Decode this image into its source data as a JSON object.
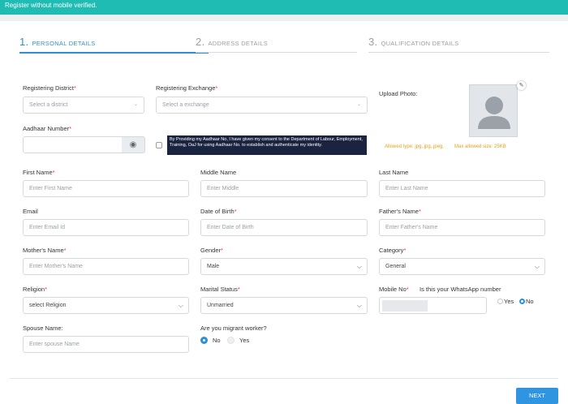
{
  "banner": {
    "text": "Register without mobile verified."
  },
  "steps": [
    {
      "num": "1.",
      "label": "PERSONAL DETAILS",
      "active": true
    },
    {
      "num": "2.",
      "label": "ADDRESS DETAILS",
      "active": false
    },
    {
      "num": "3.",
      "label": "QUALIFICATION DETAILS",
      "active": false
    }
  ],
  "fields": {
    "registering_district": {
      "label": "Registering District",
      "placeholder": "Select a district"
    },
    "registering_exchange": {
      "label": "Registering Exchange",
      "placeholder": "Select a exchange"
    },
    "upload_photo": {
      "label": "Upload Photo:"
    },
    "photo_hint_types": "Allowed type: jpg,.jpg,.jpeg.",
    "photo_hint_size": "Max allowed size: 25KB",
    "aadhaar": {
      "label": "Aadhaar Number",
      "value": ""
    },
    "consent_text": "By Providing my Aadhaar No, I have given my consent to the Department of Labour, Employment, Training, OaJ for using Aadhaar No. to establish and authenticate my identity.",
    "first_name": {
      "label": "First Name",
      "placeholder": "Enter First Name"
    },
    "middle_name": {
      "label": "Middle Name",
      "placeholder": "Enter Middle"
    },
    "last_name": {
      "label": "Last Name",
      "placeholder": "Enter Last Name"
    },
    "email": {
      "label": "Email",
      "placeholder": "Enter Email Id"
    },
    "dob": {
      "label": "Date of Birth",
      "placeholder": "Enter Date of Birth"
    },
    "father_name": {
      "label": "Father's Name",
      "placeholder": "Enter Father's Name"
    },
    "mother_name": {
      "label": "Mother's Name",
      "placeholder": "Enter Mother's Name"
    },
    "gender": {
      "label": "Gender",
      "value": "Male"
    },
    "category": {
      "label": "Category",
      "value": "General"
    },
    "religion": {
      "label": "Religion",
      "value": "select Religion"
    },
    "marital_status": {
      "label": "Marital Status",
      "value": "Unmarried"
    },
    "mobile": {
      "label": "Mobile No",
      "whatsapp_question": "Is this your WhatsApp number",
      "yes": "Yes",
      "no": "No",
      "whatsapp_selected": "No"
    },
    "spouse_name": {
      "label": "Spouse Name:",
      "placeholder": "Enter spouse Name"
    },
    "migrant": {
      "label": "Are you migrant worker?",
      "no": "No",
      "yes": "Yes",
      "selected": "No"
    }
  },
  "required_mark": "*",
  "next_button": "NEXT",
  "accent_color": "#2d8fd6",
  "banner_color": "#1fbcb3"
}
